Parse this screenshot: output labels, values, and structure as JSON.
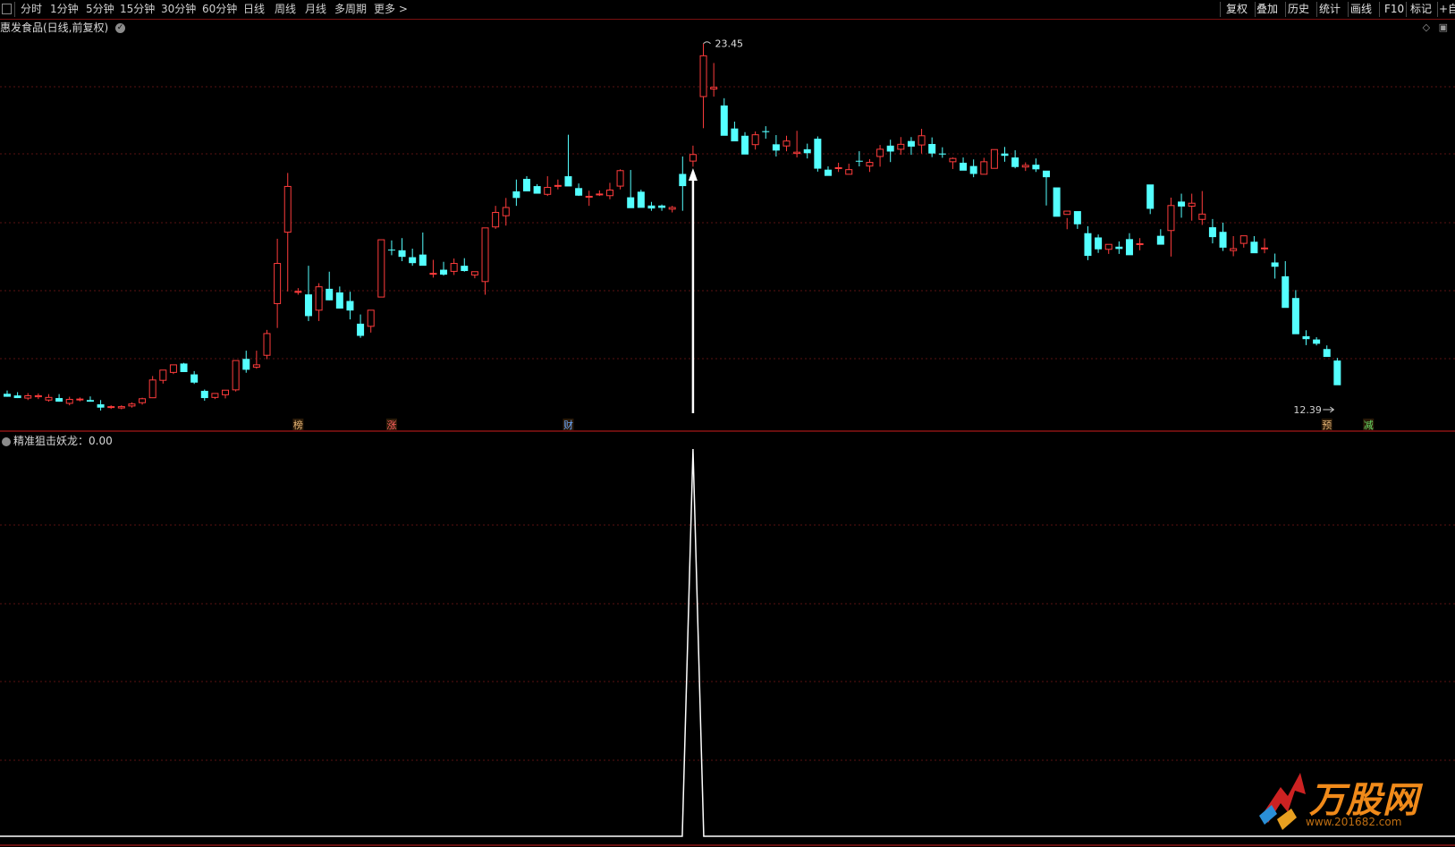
{
  "toolbar": {
    "left": [
      {
        "label": "分时"
      },
      {
        "label": "1分钟"
      },
      {
        "label": "5分钟"
      },
      {
        "label": "15分钟"
      },
      {
        "label": "30分钟"
      },
      {
        "label": "60分钟"
      },
      {
        "label": "日线"
      },
      {
        "label": "周线"
      },
      {
        "label": "月线"
      },
      {
        "label": "多周期"
      },
      {
        "label": "更多 >"
      }
    ],
    "right": [
      {
        "label": "复权"
      },
      {
        "label": "叠加"
      },
      {
        "label": "历史"
      },
      {
        "label": "统计"
      },
      {
        "label": "画线"
      },
      {
        "label": "F10"
      },
      {
        "label": "标记"
      },
      {
        "label": "+自"
      }
    ]
  },
  "chart_title": "惠发食品(日线,前复权)",
  "indicator_title": "精准狙击妖龙：0.00",
  "price_labels": {
    "high": "23.45",
    "low": "12.39"
  },
  "markers": [
    {
      "text": "榜",
      "color": "#e8b878"
    },
    {
      "text": "涨",
      "color": "#ff6060"
    },
    {
      "text": "财",
      "color": "#6aa8ff"
    },
    {
      "text": "预",
      "color": "#e8b878"
    },
    {
      "text": "减",
      "color": "#66dd66"
    }
  ],
  "colors": {
    "up": "#ff3c3c",
    "down": "#54ffff",
    "grid": "#5a1212",
    "border": "#8a1414",
    "signal": "#ffffff"
  },
  "chart_data": {
    "type": "candlestick",
    "signal_index": 66,
    "candles": [
      [
        12.79,
        12.89,
        12.7,
        12.7
      ],
      [
        12.74,
        12.84,
        12.66,
        12.66
      ],
      [
        12.66,
        12.81,
        12.6,
        12.73
      ],
      [
        12.7,
        12.8,
        12.63,
        12.73
      ],
      [
        12.6,
        12.78,
        12.55,
        12.68
      ],
      [
        12.66,
        12.78,
        12.55,
        12.55
      ],
      [
        12.5,
        12.7,
        12.44,
        12.62
      ],
      [
        12.63,
        12.68,
        12.56,
        12.63
      ],
      [
        12.6,
        12.71,
        12.55,
        12.55
      ],
      [
        12.47,
        12.6,
        12.28,
        12.37
      ],
      [
        12.38,
        12.44,
        12.33,
        12.4
      ],
      [
        12.36,
        12.44,
        12.32,
        12.4
      ],
      [
        12.42,
        12.53,
        12.37,
        12.48
      ],
      [
        12.52,
        12.67,
        12.46,
        12.64
      ],
      [
        12.67,
        13.33,
        12.66,
        13.21
      ],
      [
        13.2,
        13.5,
        13.1,
        13.51
      ],
      [
        13.44,
        13.66,
        13.39,
        13.67
      ],
      [
        13.71,
        13.73,
        13.47,
        13.45
      ],
      [
        13.38,
        13.48,
        13.09,
        13.13
      ],
      [
        12.88,
        12.92,
        12.58,
        12.66
      ],
      [
        12.68,
        12.8,
        12.63,
        12.8
      ],
      [
        12.76,
        12.9,
        12.65,
        12.9
      ],
      [
        12.91,
        13.75,
        12.86,
        13.8
      ],
      [
        13.85,
        14.1,
        13.43,
        13.52
      ],
      [
        13.6,
        14.1,
        13.55,
        13.67
      ],
      [
        13.96,
        14.73,
        13.84,
        14.62
      ],
      [
        15.53,
        17.5,
        14.79,
        16.75
      ],
      [
        17.7,
        19.5,
        15.9,
        19.09
      ],
      [
        15.9,
        16.0,
        15.8,
        15.9
      ],
      [
        15.81,
        16.68,
        15.0,
        15.15
      ],
      [
        15.33,
        16.15,
        15.0,
        16.04
      ],
      [
        15.98,
        16.5,
        15.63,
        15.63
      ],
      [
        15.87,
        16.05,
        15.38,
        15.38
      ],
      [
        15.61,
        15.89,
        15.05,
        15.32
      ],
      [
        14.92,
        15.2,
        14.49,
        14.55
      ],
      [
        14.84,
        15.32,
        14.65,
        15.33
      ],
      [
        15.73,
        17.09,
        15.85,
        17.47
      ],
      [
        17.17,
        17.45,
        17.0,
        17.15
      ],
      [
        17.15,
        17.52,
        16.82,
        16.95
      ],
      [
        16.94,
        17.2,
        16.68,
        16.76
      ],
      [
        17.02,
        17.69,
        16.71,
        16.68
      ],
      [
        16.43,
        16.86,
        16.32,
        16.45
      ],
      [
        16.56,
        16.8,
        16.38,
        16.41
      ],
      [
        16.51,
        16.9,
        16.4,
        16.75
      ],
      [
        16.68,
        16.91,
        16.5,
        16.52
      ],
      [
        16.4,
        16.5,
        16.3,
        16.5
      ],
      [
        16.2,
        17.0,
        15.8,
        17.83
      ],
      [
        17.86,
        18.5,
        17.8,
        18.3
      ],
      [
        18.2,
        18.74,
        17.9,
        18.45
      ],
      [
        18.94,
        19.3,
        18.5,
        18.74
      ],
      [
        19.32,
        19.4,
        18.96,
        18.94
      ],
      [
        19.1,
        19.16,
        18.88,
        18.87
      ],
      [
        18.85,
        19.4,
        18.8,
        19.06
      ],
      [
        19.12,
        19.3,
        19.0,
        19.12
      ],
      [
        19.4,
        20.66,
        19.25,
        19.09
      ],
      [
        19.04,
        19.18,
        18.8,
        18.81
      ],
      [
        18.77,
        18.96,
        18.5,
        18.79
      ],
      [
        18.86,
        18.97,
        18.8,
        18.86
      ],
      [
        18.81,
        19.2,
        18.7,
        18.98
      ],
      [
        19.1,
        19.61,
        19.0,
        19.57
      ],
      [
        18.76,
        19.59,
        18.64,
        18.43
      ],
      [
        18.93,
        18.99,
        18.47,
        18.44
      ],
      [
        18.51,
        18.62,
        18.35,
        18.42
      ],
      [
        18.51,
        18.54,
        18.35,
        18.44
      ],
      [
        18.4,
        18.5,
        18.3,
        18.45
      ],
      [
        19.47,
        20.0,
        18.35,
        19.1
      ],
      [
        19.86,
        20.33,
        19.69,
        20.06
      ],
      [
        21.82,
        23.43,
        20.86,
        23.06
      ],
      [
        22.05,
        22.84,
        21.82,
        22.1
      ],
      [
        21.55,
        21.77,
        20.64,
        20.63
      ],
      [
        20.85,
        21.06,
        20.5,
        20.46
      ],
      [
        20.63,
        20.74,
        20.07,
        20.06
      ],
      [
        20.36,
        20.76,
        20.21,
        20.66
      ],
      [
        20.77,
        20.92,
        20.54,
        20.74
      ],
      [
        20.37,
        20.65,
        20.0,
        20.18
      ],
      [
        20.32,
        20.63,
        20.16,
        20.47
      ],
      [
        20.09,
        20.78,
        19.97,
        20.13
      ],
      [
        20.22,
        20.39,
        19.94,
        20.1
      ],
      [
        20.54,
        20.61,
        19.54,
        19.63
      ],
      [
        19.6,
        19.7,
        19.45,
        19.41
      ],
      [
        19.64,
        19.81,
        19.53,
        19.66
      ],
      [
        19.46,
        19.78,
        19.5,
        19.6
      ],
      [
        19.87,
        20.16,
        19.7,
        19.85
      ],
      [
        19.71,
        19.92,
        19.53,
        19.82
      ],
      [
        20.0,
        20.35,
        19.69,
        20.22
      ],
      [
        20.33,
        20.51,
        19.83,
        20.15
      ],
      [
        20.22,
        20.59,
        20.05,
        20.37
      ],
      [
        20.47,
        20.59,
        20.05,
        20.3
      ],
      [
        20.35,
        20.84,
        20.09,
        20.63
      ],
      [
        20.38,
        20.58,
        19.98,
        20.09
      ],
      [
        20.09,
        20.28,
        19.96,
        20.06
      ],
      [
        19.84,
        19.97,
        19.62,
        19.94
      ],
      [
        19.81,
        19.97,
        19.65,
        19.57
      ],
      [
        19.71,
        19.91,
        19.37,
        19.47
      ],
      [
        19.46,
        19.96,
        19.51,
        19.84
      ],
      [
        19.64,
        20.04,
        19.69,
        20.21
      ],
      [
        20.09,
        20.29,
        19.84,
        20.02
      ],
      [
        19.97,
        20.19,
        19.64,
        19.68
      ],
      [
        19.68,
        19.82,
        19.56,
        19.73
      ],
      [
        19.75,
        19.94,
        19.53,
        19.61
      ],
      [
        19.57,
        19.43,
        18.51,
        19.37
      ],
      [
        19.06,
        18.91,
        18.26,
        18.17
      ],
      [
        18.24,
        18.13,
        17.79,
        18.34
      ],
      [
        18.34,
        18.24,
        17.8,
        17.94
      ],
      [
        17.67,
        17.88,
        16.85,
        16.98
      ],
      [
        17.54,
        17.63,
        17.07,
        17.18
      ],
      [
        17.18,
        17.31,
        17.04,
        17.33
      ],
      [
        17.26,
        17.42,
        17.04,
        17.19
      ],
      [
        17.49,
        17.67,
        17.14,
        17.0
      ],
      [
        17.34,
        17.52,
        17.15,
        17.35
      ],
      [
        19.15,
        19.05,
        18.25,
        18.41
      ],
      [
        17.59,
        17.79,
        17.35,
        17.32
      ],
      [
        17.75,
        18.75,
        16.96,
        18.51
      ],
      [
        18.63,
        18.87,
        18.14,
        18.48
      ],
      [
        18.49,
        18.87,
        18.05,
        18.58
      ],
      [
        18.09,
        18.95,
        17.92,
        18.25
      ],
      [
        17.85,
        18.1,
        17.36,
        17.55
      ],
      [
        17.71,
        17.99,
        17.13,
        17.23
      ],
      [
        17.14,
        17.58,
        16.97,
        17.2
      ],
      [
        17.36,
        17.46,
        17.23,
        17.59
      ],
      [
        17.41,
        17.58,
        17.08,
        17.06
      ],
      [
        17.21,
        17.51,
        17.06,
        17.22
      ],
      [
        16.78,
        17.05,
        16.29,
        16.65
      ],
      [
        16.36,
        16.82,
        15.84,
        15.4
      ],
      [
        15.7,
        15.94,
        14.89,
        14.6
      ],
      [
        14.54,
        14.72,
        14.27,
        14.45
      ],
      [
        14.44,
        14.51,
        14.26,
        14.31
      ],
      [
        14.15,
        14.26,
        14.02,
        13.91
      ],
      [
        13.8,
        13.88,
        13.32,
        13.05
      ]
    ]
  }
}
